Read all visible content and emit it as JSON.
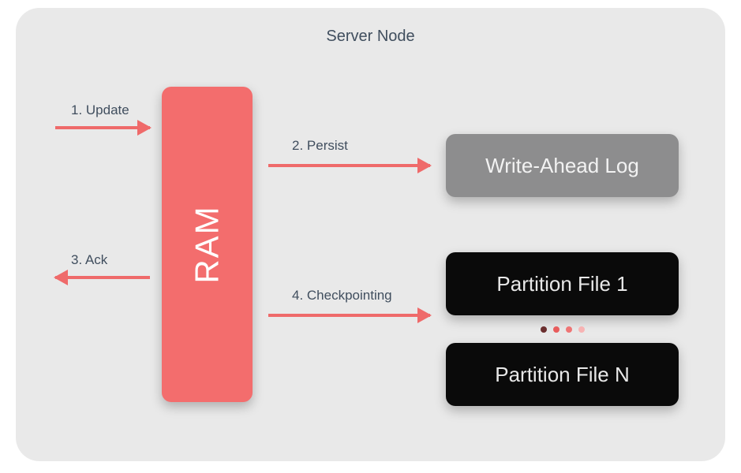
{
  "title": "Server Node",
  "nodes": {
    "ram": "RAM",
    "wal": "Write-Ahead Log",
    "pf1": "Partition File 1",
    "pfn": "Partition File N"
  },
  "steps": {
    "s1": "1. Update",
    "s2": "2. Persist",
    "s3": "3. Ack",
    "s4": "4. Checkpointing"
  },
  "colors": {
    "accent": "#ef6a6a",
    "ram_bg": "#f36d6d",
    "wal_bg": "#8d8d8e",
    "file_bg": "#0a0a0a",
    "panel_bg": "#e9e9e9",
    "text": "#404e5e"
  }
}
